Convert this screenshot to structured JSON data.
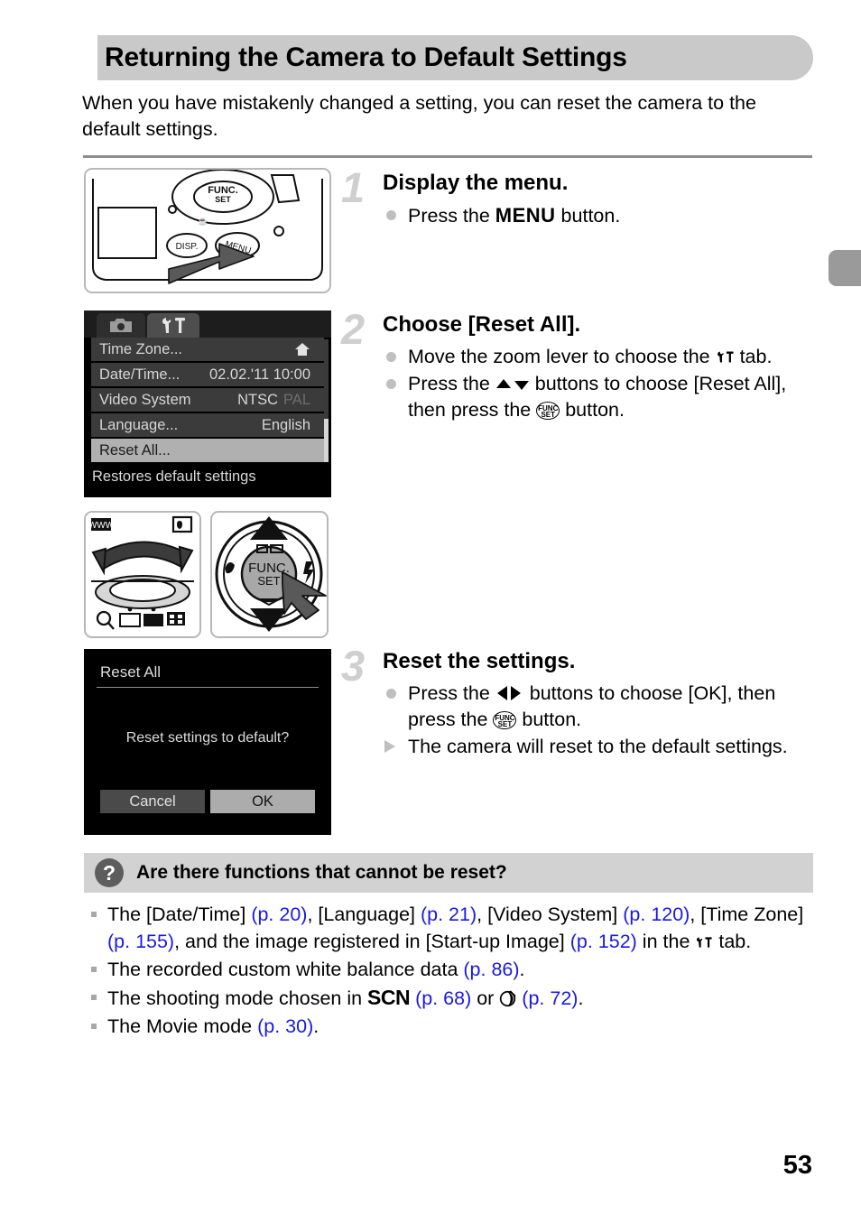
{
  "page": {
    "title": "Returning the Camera to Default Settings",
    "intro": "When you have mistakenly changed a setting, you can reset the camera to the default settings.",
    "page_number": "53",
    "accent_link_color": "#1a1ae0",
    "banner_color": "#c9c9c9",
    "faq_bar_color": "#d2d2d2"
  },
  "steps": [
    {
      "number": "1",
      "title": "Display the menu.",
      "bullets": [
        {
          "marker": "dot",
          "pre": "Press the ",
          "keyword": "MENU",
          "post": " button."
        }
      ]
    },
    {
      "number": "2",
      "title": "Choose [Reset All].",
      "bullets": [
        {
          "marker": "dot",
          "pre": "Move the zoom lever to choose the ",
          "icon": "settings-tab-icon",
          "post": " tab."
        },
        {
          "marker": "dot",
          "pre": "Press the ",
          "icon": "up-down-arrows-icon",
          "mid": " buttons to choose [Reset All], then press the ",
          "icon2": "func-set-button-icon",
          "post": " button."
        }
      ]
    },
    {
      "number": "3",
      "title": "Reset the settings.",
      "bullets": [
        {
          "marker": "dot",
          "pre": "Press the ",
          "icon": "left-right-arrows-icon",
          "mid": " buttons to choose [OK], then press the ",
          "icon2": "func-set-button-icon",
          "post": " button."
        },
        {
          "marker": "triangle",
          "pre": "The camera will reset to the default settings."
        }
      ]
    }
  ],
  "camera_menu_screenshot": {
    "tabs": [
      {
        "name": "camera-tab",
        "icon": "camera-icon",
        "active": false
      },
      {
        "name": "settings-tab",
        "icon": "wrench-hammer-icon",
        "active": true
      }
    ],
    "rows": [
      {
        "label": "Time Zone...",
        "value": "",
        "icon": "home-icon",
        "selected": false
      },
      {
        "label": "Date/Time...",
        "value": "02.02.'11 10:00",
        "selected": false
      },
      {
        "label": "Video System",
        "value": "NTSC",
        "value_dim": "PAL",
        "selected": false
      },
      {
        "label": "Language...",
        "value": "English",
        "selected": false
      },
      {
        "label": "Reset All...",
        "value": "",
        "selected": true
      }
    ],
    "footer": "Restores default settings"
  },
  "reset_dialog_screenshot": {
    "title": "Reset All",
    "message": "Reset settings to default?",
    "buttons": [
      {
        "label": "Cancel",
        "selected": false
      },
      {
        "label": "OK",
        "selected": true
      }
    ]
  },
  "figures": {
    "camera_back": "camera-back-menu-button-illustration",
    "zoom_lever": "zoom-lever-illustration",
    "control_pad": "control-pad-func-set-illustration"
  },
  "faq": {
    "icon": "question-mark-icon",
    "title": "Are there functions that cannot be reset?",
    "items": [
      {
        "segments": [
          {
            "t": "The [Date/Time] "
          },
          {
            "t": "(p. 20)",
            "link": true
          },
          {
            "t": ", [Language] "
          },
          {
            "t": "(p. 21)",
            "link": true
          },
          {
            "t": ", [Video System] "
          },
          {
            "t": "(p. 120)",
            "link": true
          },
          {
            "t": ", [Time Zone] "
          },
          {
            "t": "(p. 155)",
            "link": true
          },
          {
            "t": ", and the image registered in [Start-up Image] "
          },
          {
            "t": "(p. 152)",
            "link": true
          },
          {
            "t": " in the "
          },
          {
            "icon": "settings-tab-icon"
          },
          {
            "t": " tab."
          }
        ]
      },
      {
        "segments": [
          {
            "t": "The recorded custom white balance data "
          },
          {
            "t": "(p. 86)",
            "link": true
          },
          {
            "t": "."
          }
        ]
      },
      {
        "segments": [
          {
            "t": "The shooting mode chosen in "
          },
          {
            "t": "SCN",
            "bold_mode": true
          },
          {
            "t": " "
          },
          {
            "t": "(p. 68)",
            "link": true
          },
          {
            "t": " or "
          },
          {
            "icon": "creative-filter-icon"
          },
          {
            "t": " "
          },
          {
            "t": "(p. 72)",
            "link": true
          },
          {
            "t": "."
          }
        ]
      },
      {
        "segments": [
          {
            "t": "The Movie mode "
          },
          {
            "t": "(p. 30)",
            "link": true
          },
          {
            "t": "."
          }
        ]
      }
    ]
  }
}
